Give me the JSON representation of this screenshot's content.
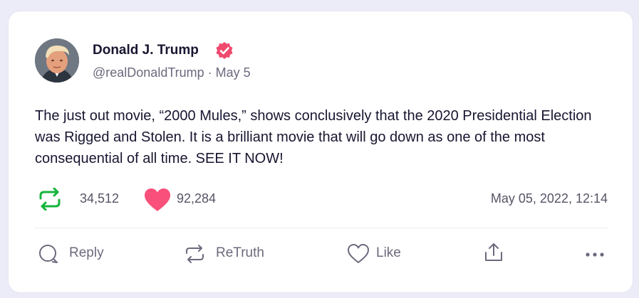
{
  "post": {
    "author_name": "Donald J. Trump",
    "handle_line": "@realDonaldTrump · May 5",
    "text": "The just out movie, “2000 Mules,” shows conclusively that the 2020 Presidential Election was Rigged and Stolen. It is a brilliant movie that will go down as one of the most consequential of all time. SEE IT NOW!",
    "retruth_count": "34,512",
    "like_count": "92,284",
    "timestamp": "May 05, 2022, 12:14"
  },
  "actions": {
    "reply": "Reply",
    "retruth": "ReTruth",
    "like": "Like"
  },
  "icons": {
    "verified": "verified-badge-icon",
    "retruth": "retruth-icon",
    "like": "heart-icon",
    "reply": "reply-icon",
    "share": "share-icon",
    "more": "more-icon"
  },
  "colors": {
    "verified": "#ef4a6e",
    "retruth_green": "#15b43c",
    "like_pink": "#f8507a",
    "text_dark": "#181630",
    "text_muted": "#6b6a7d"
  }
}
